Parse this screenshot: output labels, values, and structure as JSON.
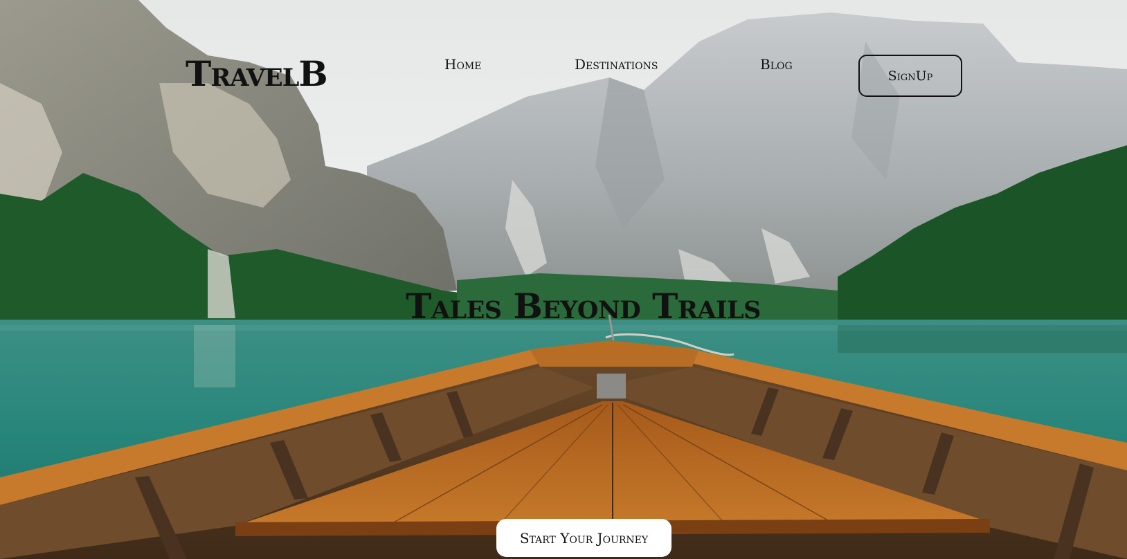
{
  "brand": {
    "logo_text": "TravelB"
  },
  "nav": {
    "links": [
      {
        "label": "Home"
      },
      {
        "label": "Destinations"
      },
      {
        "label": "Blog"
      }
    ],
    "signup_label": "SignUp"
  },
  "hero": {
    "headline": "Tales Beyond Trails",
    "cta_label": "Start Your Journey",
    "background_image": "mountain-lake-boat-bow",
    "colors": {
      "sky": "#e9ecec",
      "mountain": "#b9bdbf",
      "forest": "#1f5a2a",
      "lake": "#2a8c80",
      "boat_wood": "#b8651e",
      "text": "#111111"
    }
  }
}
